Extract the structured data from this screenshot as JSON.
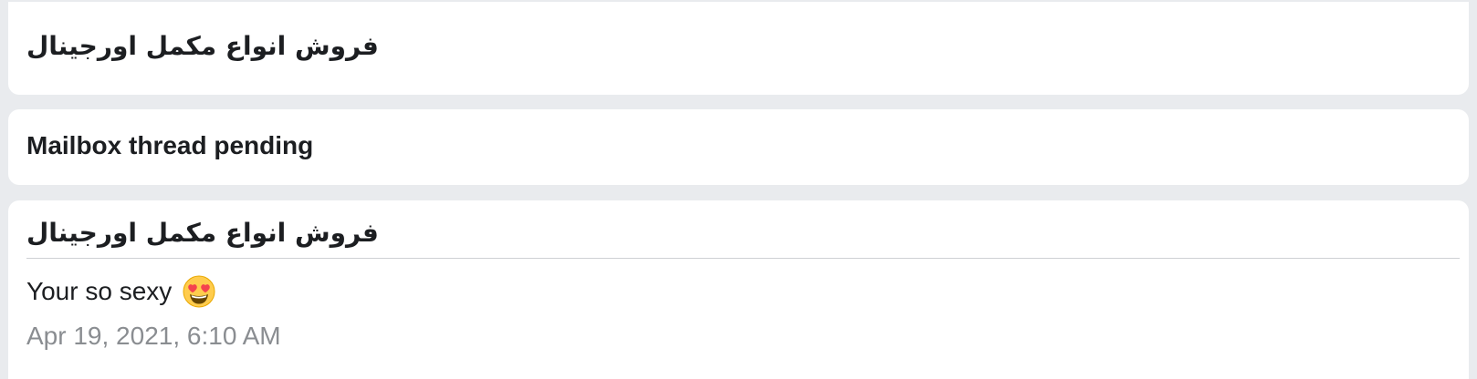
{
  "cards": [
    {
      "title": "فروش انواع مکمل اورجینال"
    },
    {
      "title": "Mailbox thread pending"
    },
    {
      "title": "فروش انواع مکمل اورجینال",
      "message": {
        "text": "Your so sexy",
        "emoji": "heart-eyes-emoji",
        "timestamp": "Apr 19, 2021, 6:10 AM"
      }
    }
  ],
  "colors": {
    "page_background": "#e9ebee",
    "card_background": "#ffffff",
    "text_primary": "#1c1e21",
    "text_secondary": "#8a8d91",
    "divider": "#ced0d4"
  }
}
